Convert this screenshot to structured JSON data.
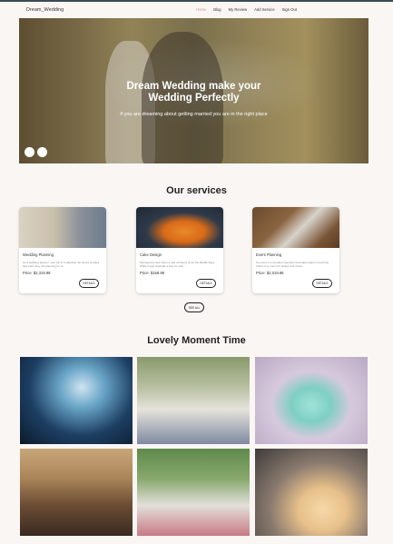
{
  "nav": {
    "brand": "Dream_Wedding",
    "links": [
      "Home",
      "Blog",
      "My Review",
      "Add Service",
      "Sign Out"
    ]
  },
  "hero": {
    "title_line1": "Dream Wedding make your",
    "title_line2": "Wedding Perfectly",
    "subtitle": "if you are dreaming about getting married you are in the right place"
  },
  "services": {
    "title": "Our services",
    "cards": [
      {
        "title": "Wedding Planning",
        "desc": "As a wedding planner, your job is to alleviate the stress couples feel when they are planning for th...",
        "price": "Price: $2,319.98",
        "button": "DETAILS"
      },
      {
        "title": "Cake Design",
        "desc": "Monograms have been a part of history since the Middle Ages. While it was originally a way for vehi...",
        "price": "Price: $158.98",
        "button": "DETAILS"
      },
      {
        "title": "Event Planning",
        "desc": "So event is a complex operation that takes place in real time. There is no room for delays and miscu...",
        "price": "Price: $2,019.98",
        "button": "DETAILS"
      }
    ],
    "see_all": "SEE ALL"
  },
  "gallery": {
    "title": "Lovely Moment Time"
  }
}
